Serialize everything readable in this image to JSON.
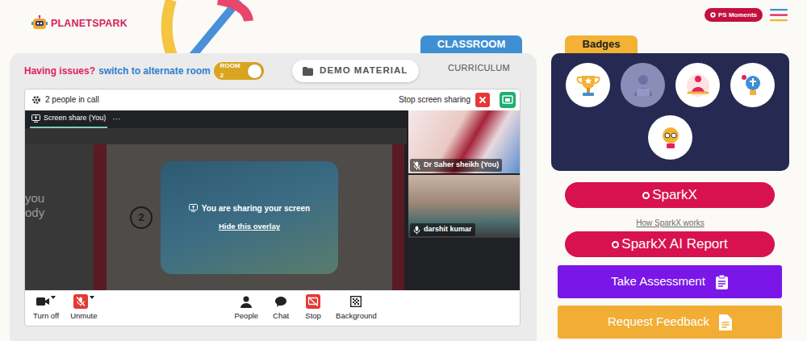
{
  "header": {
    "logo": "PLANETSPARK",
    "moments_button": "PS Moments"
  },
  "classroom": {
    "tabs": [
      {
        "label": "CLASSROOM",
        "selected": true
      },
      {
        "label": "CURRICULUM",
        "selected": false
      }
    ],
    "issues_label": "Having issues?",
    "switch_link": "switch to alternate room",
    "room_toggle": {
      "label": "ROOM 2",
      "on": true
    },
    "demo_button": "DEMO MATERIAL"
  },
  "call": {
    "people": "2 people in call",
    "stop_sharing": "Stop screen sharing",
    "share_tab": {
      "label": "Screen share (You)",
      "selected": true
    },
    "share_menu": "···",
    "slide": {
      "lines": [
        "you",
        "ody"
      ],
      "number": "2"
    },
    "overlay": {
      "message": "You are sharing your screen",
      "hide_link": "Hide this overlay"
    },
    "participants": [
      {
        "name": "Dr Saher sheikh (You)",
        "muted": true
      },
      {
        "name": "darshit kumar",
        "muted": false
      }
    ],
    "controls": [
      {
        "label": "Turn off",
        "alert": false,
        "dropdown": true
      },
      {
        "label": "Unmute",
        "alert": true,
        "dropdown": true
      },
      {
        "label": "People",
        "alert": false,
        "dropdown": false
      },
      {
        "label": "Chat",
        "alert": false,
        "dropdown": false
      },
      {
        "label": "Stop",
        "alert": true,
        "dropdown": false
      },
      {
        "label": "Background",
        "alert": false,
        "dropdown": false
      }
    ]
  },
  "badges": {
    "title": "Badges",
    "items": [
      {
        "earned": true
      },
      {
        "earned": false
      },
      {
        "earned": true
      },
      {
        "earned": true
      },
      {
        "earned": true
      }
    ]
  },
  "actions": [
    {
      "kind": "pill",
      "label": "SparkX",
      "color": "#d8124e"
    },
    {
      "kind": "link",
      "label": "How SparkX works",
      "color": "#6c6c6c"
    },
    {
      "kind": "pill",
      "label": "SparkX AI Report",
      "color": "#d8124e"
    },
    {
      "kind": "block",
      "label": "Take Assessment",
      "color": "#7a16e8"
    },
    {
      "kind": "block",
      "label": "Request Feedback",
      "color": "#f2ad34"
    },
    {
      "kind": "block",
      "color": "#3f7fd0"
    }
  ]
}
